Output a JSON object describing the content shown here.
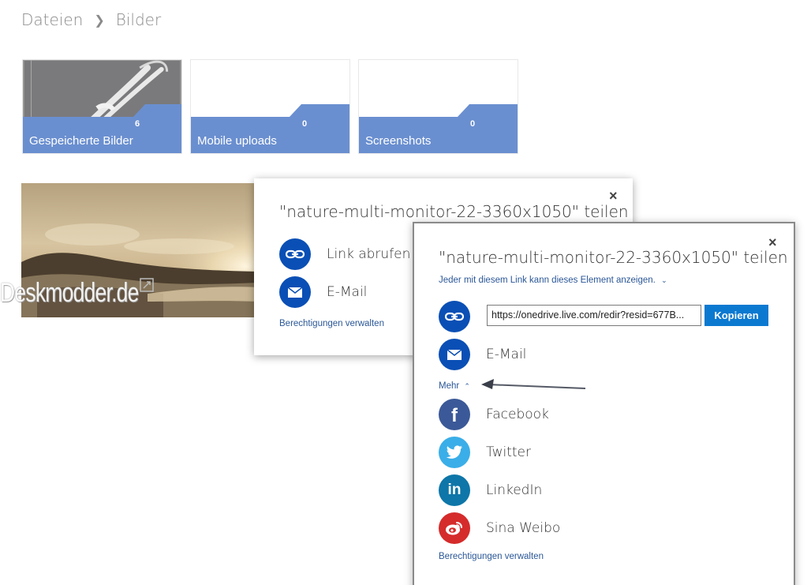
{
  "breadcrumb": {
    "root": "Dateien",
    "separator": ">",
    "current": "Bilder"
  },
  "folders": [
    {
      "label": "Gespeicherte Bilder",
      "count": "6"
    },
    {
      "label": "Mobile uploads",
      "count": "0"
    },
    {
      "label": "Screenshots",
      "count": "0"
    }
  ],
  "watermark": "Deskmodder.de",
  "dialog_back": {
    "title": "\"nature-multi-monitor-22-3360x1050\" teilen",
    "options": [
      {
        "label": "Link abrufen",
        "icon": "link-icon"
      },
      {
        "label": "E-Mail",
        "icon": "mail-icon"
      }
    ],
    "permissions": "Berechtigungen verwalten",
    "close": "×"
  },
  "dialog_front": {
    "title": "\"nature-multi-monitor-22-3360x1050\" teilen",
    "access": "Jeder mit diesem Link kann dieses Element anzeigen.",
    "url": "https://onedrive.live.com/redir?resid=677B...",
    "copy": "Kopieren",
    "email": "E-Mail",
    "more": "Mehr",
    "social": [
      {
        "label": "Facebook",
        "icon": "facebook-icon",
        "color": "#3b5998"
      },
      {
        "label": "Twitter",
        "icon": "twitter-icon",
        "color": "#1da1f2"
      },
      {
        "label": "LinkedIn",
        "icon": "linkedin-icon",
        "color": "#0e76a8"
      },
      {
        "label": "Sina Weibo",
        "icon": "weibo-icon",
        "color": "#d52b2b"
      }
    ],
    "permissions": "Berechtigungen verwalten",
    "close": "×"
  },
  "colors": {
    "tile_bar": "#6a8fd0",
    "action_circle": "#0a4fb5",
    "link": "#2b5797",
    "button": "#0b79d0"
  }
}
